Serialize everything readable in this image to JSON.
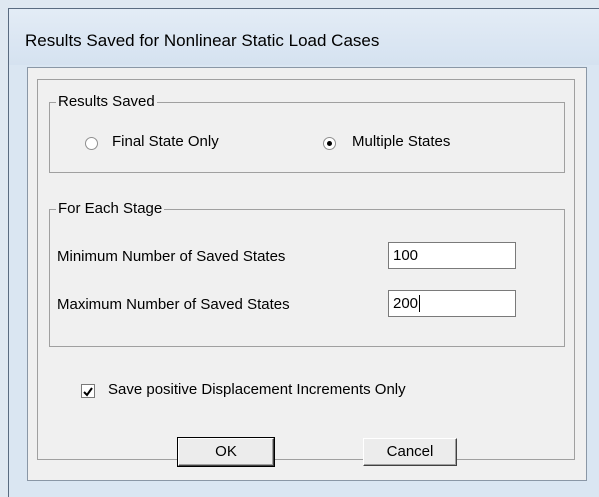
{
  "window": {
    "title": "Results Saved for Nonlinear Static Load Cases"
  },
  "results_saved": {
    "caption": "Results Saved",
    "options": [
      {
        "label": "Final State Only",
        "selected": false
      },
      {
        "label": "Multiple States",
        "selected": true
      }
    ]
  },
  "each_stage": {
    "caption": "For Each Stage",
    "min_label": "Minimum Number of Saved States",
    "min_value": "100",
    "max_label": "Maximum Number of Saved States",
    "max_value": "200"
  },
  "save_positive": {
    "label": "Save positive Displacement Increments Only",
    "checked": true
  },
  "buttons": {
    "ok": "OK",
    "cancel": "Cancel"
  }
}
